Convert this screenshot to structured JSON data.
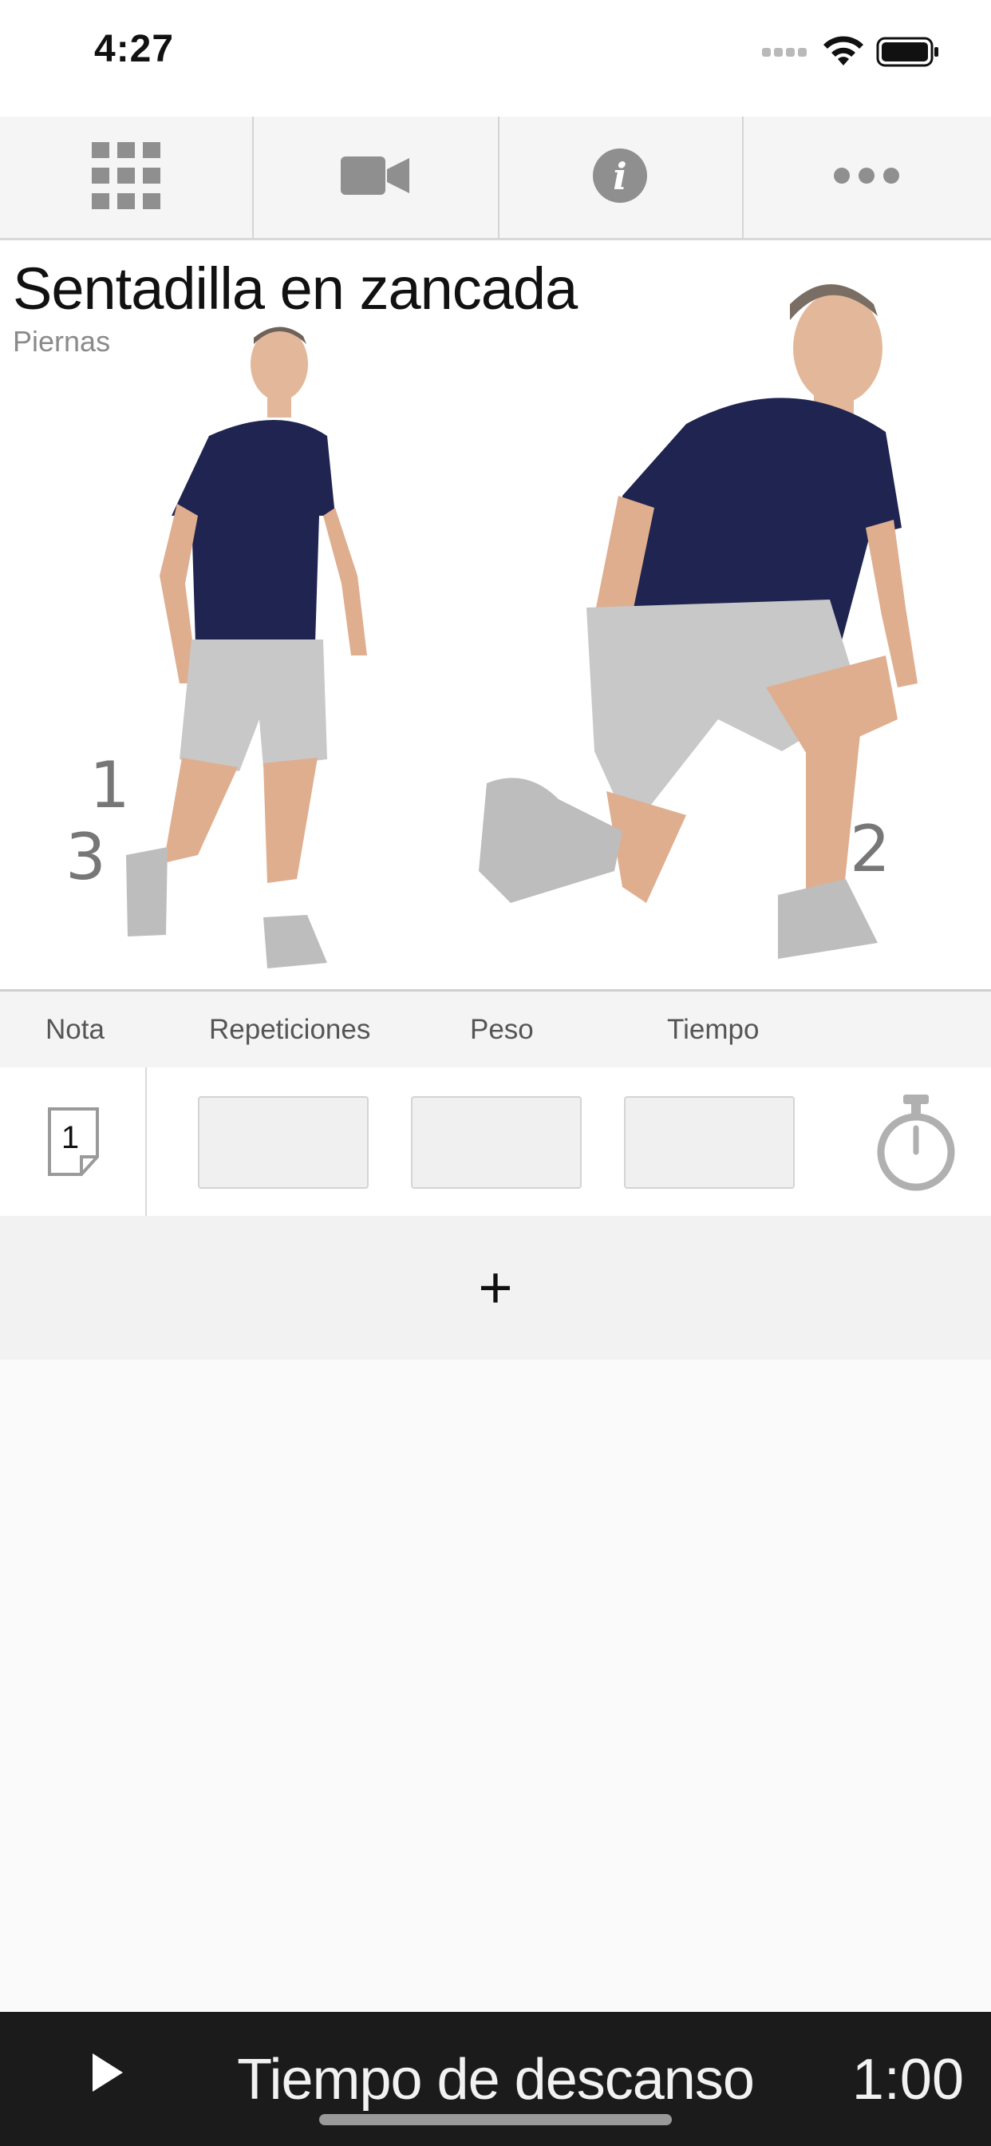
{
  "status_bar": {
    "time": "4:27"
  },
  "toolbar": {
    "items": [
      {
        "icon": "grid-icon"
      },
      {
        "icon": "video-camera-icon"
      },
      {
        "icon": "info-icon"
      },
      {
        "icon": "more-icon"
      }
    ]
  },
  "exercise": {
    "title": "Sentadilla en zancada",
    "category": "Piernas",
    "step_labels": [
      "1",
      "3",
      "2"
    ]
  },
  "table": {
    "headers": {
      "note": "Nota",
      "reps": "Repeticiones",
      "weight": "Peso",
      "time": "Tiempo"
    },
    "sets": [
      {
        "number": "1",
        "reps": "",
        "weight": "",
        "time": ""
      }
    ]
  },
  "add_label": "+",
  "rest": {
    "label": "Tiempo de descanso",
    "time": "1:00"
  },
  "colors": {
    "bottom_bar": "#1b1b1b",
    "shirt": "#1f2450",
    "shorts": "#c8c8c8"
  }
}
